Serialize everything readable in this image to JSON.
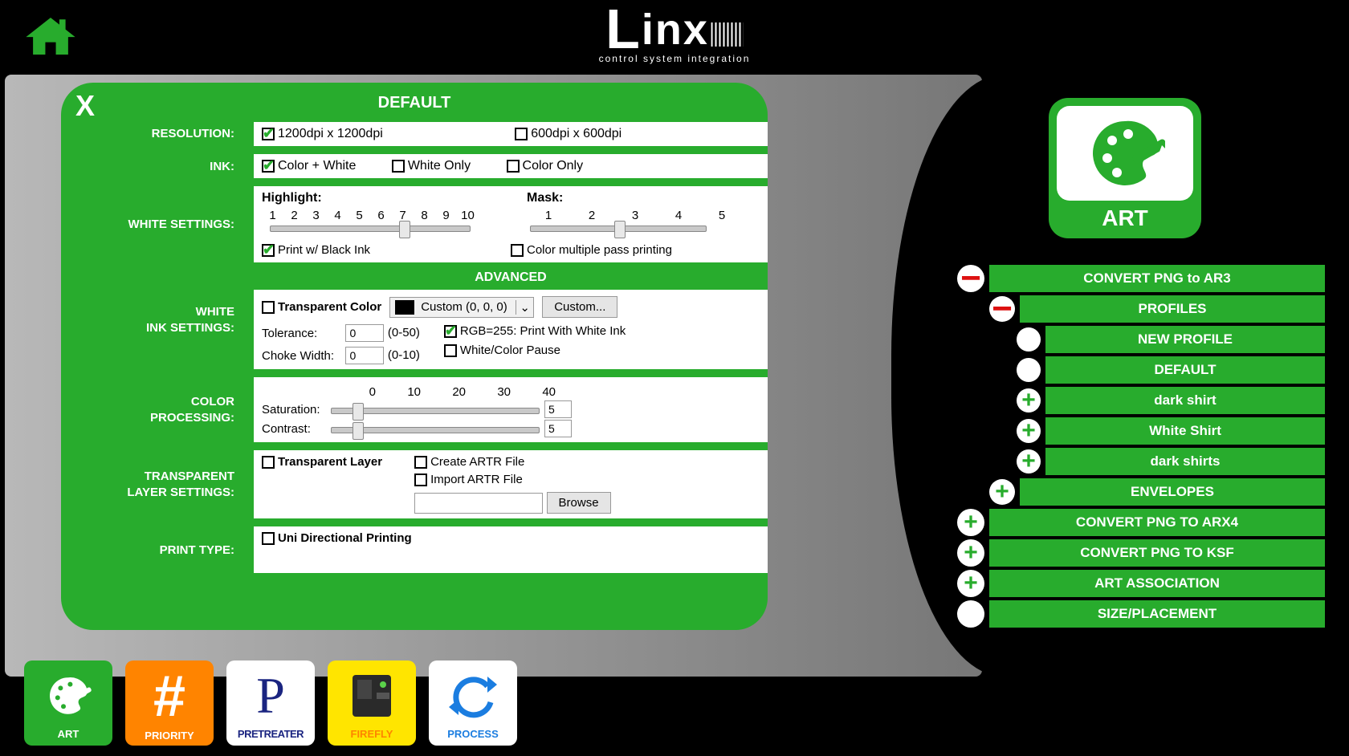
{
  "logo": {
    "name": "Linx",
    "tagline": "control system integration"
  },
  "panel": {
    "title": "DEFAULT",
    "close": "X",
    "resolution": {
      "label": "RESOLUTION:",
      "options": [
        "1200dpi x 1200dpi",
        "600dpi x 600dpi"
      ],
      "selected": 0
    },
    "ink": {
      "label": "INK:",
      "options": [
        "Color + White",
        "White Only",
        "Color Only"
      ],
      "selected": 0
    },
    "white_settings": {
      "label": "WHITE SETTINGS:",
      "highlight_label": "Highlight:",
      "highlight_ticks": [
        "1",
        "2",
        "3",
        "4",
        "5",
        "6",
        "7",
        "8",
        "9",
        "10"
      ],
      "highlight_value": 7,
      "mask_label": "Mask:",
      "mask_ticks": [
        "1",
        "2",
        "3",
        "4",
        "5"
      ],
      "mask_value": 3,
      "print_black_ink": {
        "label": "Print w/ Black Ink",
        "checked": true
      },
      "color_multipass": {
        "label": "Color multiple pass printing",
        "checked": false
      }
    },
    "advanced_label": "ADVANCED",
    "white_ink": {
      "label": "WHITE INK SETTINGS:",
      "transparent_color": {
        "label": "Transparent Color",
        "checked": false
      },
      "combo_text": "Custom (0, 0, 0)",
      "custom_btn": "Custom...",
      "tolerance_label": "Tolerance:",
      "tolerance_value": "0",
      "tolerance_range": "(0-50)",
      "choke_label": "Choke Width:",
      "choke_value": "0",
      "choke_range": "(0-10)",
      "rgb255": {
        "label": "RGB=255: Print With White Ink",
        "checked": true
      },
      "wc_pause": {
        "label": "White/Color Pause",
        "checked": false
      }
    },
    "color_proc": {
      "label": "COLOR PROCESSING:",
      "ticks": [
        "0",
        "10",
        "20",
        "30",
        "40"
      ],
      "saturation_label": "Saturation:",
      "saturation_value": "5",
      "contrast_label": "Contrast:",
      "contrast_value": "5"
    },
    "transparent_layer": {
      "label": "TRANSPARENT LAYER SETTINGS:",
      "tl": {
        "label": "Transparent Layer",
        "checked": false
      },
      "create": {
        "label": "Create ARTR File",
        "checked": false
      },
      "import": {
        "label": "Import ARTR File",
        "checked": false
      },
      "path": "",
      "browse": "Browse"
    },
    "print_type": {
      "label": "PRINT TYPE:",
      "uni": {
        "label": "Uni Directional Printing",
        "checked": false
      }
    }
  },
  "sidebar": {
    "title": "ART",
    "items": [
      {
        "indent": 0,
        "icon": "minus",
        "label": "CONVERT PNG to AR3"
      },
      {
        "indent": 1,
        "icon": "minus",
        "label": "PROFILES"
      },
      {
        "indent": 2,
        "icon": "blank",
        "label": "NEW PROFILE"
      },
      {
        "indent": 2,
        "icon": "blank",
        "label": "DEFAULT"
      },
      {
        "indent": 2,
        "icon": "plus",
        "label": "dark shirt"
      },
      {
        "indent": 2,
        "icon": "plus",
        "label": "White Shirt"
      },
      {
        "indent": 2,
        "icon": "plus",
        "label": "dark shirts"
      },
      {
        "indent": 1,
        "icon": "plus",
        "label": "ENVELOPES"
      },
      {
        "indent": 0,
        "icon": "plus",
        "label": "CONVERT PNG TO ARX4"
      },
      {
        "indent": 0,
        "icon": "plus",
        "label": "CONVERT PNG TO KSF"
      },
      {
        "indent": 0,
        "icon": "plus",
        "label": "ART ASSOCIATION"
      },
      {
        "indent": 0,
        "icon": "blank",
        "label": "SIZE/PLACEMENT"
      }
    ]
  },
  "dock": {
    "art": "ART",
    "priority": "PRIORITY",
    "pretreater": "PRETREATER",
    "firefly": "FIREFLY",
    "process": "PROCESS"
  }
}
